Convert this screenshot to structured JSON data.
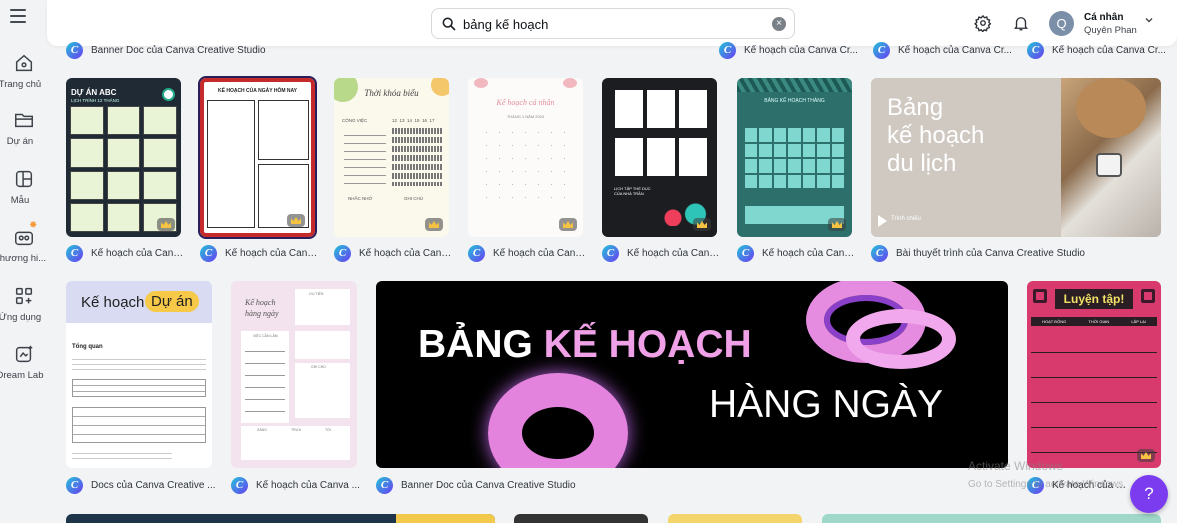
{
  "sidebar": {
    "items": [
      {
        "label": "Trang chủ",
        "icon": "home-icon"
      },
      {
        "label": "Dự án",
        "icon": "folder-icon"
      },
      {
        "label": "Mẫu",
        "icon": "template-icon"
      },
      {
        "label": "Thương hi...",
        "icon": "brand-icon"
      },
      {
        "label": "Ứng dụng",
        "icon": "apps-icon"
      },
      {
        "label": "Dream Lab",
        "icon": "dream-lab-icon"
      }
    ]
  },
  "header": {
    "search_value": "bảng kế hoạch",
    "clear_symbol": "×",
    "account_name": "Cá nhân",
    "account_sub": "Quyên Phan",
    "avatar_letter": "Q"
  },
  "top_captions": [
    "Banner Doc của Canva Creative Studio",
    "Kế hoạch của Canva Cr...",
    "Kế hoạch của Canva Cr...",
    "Kế hoạch của Canva Cr..."
  ],
  "row1": [
    {
      "caption": "Kế hoạch của Canva ...",
      "title": "DỰ ÁN ABC",
      "subtitle": "LỊCH TRÌNH 12 THÁNG"
    },
    {
      "caption": "Kế hoạch của Canva ...",
      "title": "KẾ HOẠCH CỦA NGÀY HÔM NAY"
    },
    {
      "caption": "Kế hoạch của Canva ...",
      "title": "Thời khóa biểu",
      "col1": "CÔNG VIỆC",
      "nums": "12  13  14  15  16  17",
      "note1": "NHẮC NHỞ",
      "note2": "GHI CHÚ"
    },
    {
      "caption": "Kế hoạch của Canva ...",
      "title": "Kế hoạch cá nhân",
      "subtitle": "THÁNG 1 NĂM 2024"
    },
    {
      "caption": "Kế hoạch của Canva ...",
      "title": "LỊCH TẬP THỂ DỤC CỦA NHÀ TRẦN"
    },
    {
      "caption": "Kế hoạch của Canva ...",
      "title": "BẢNG KẾ HOẠCH THÁNG"
    },
    {
      "caption": "Bài thuyết trình của Canva Creative Studio",
      "title_lines": [
        "Bảng",
        "kế hoạch",
        "du lịch"
      ],
      "footer": "Trình chiếu"
    }
  ],
  "row2": [
    {
      "caption": "Docs của Canva Creative ...",
      "title_a": "Kế hoạch",
      "title_b": "Dự án",
      "section": "Tổng quan"
    },
    {
      "caption": "Kế hoạch của Canva ...",
      "title": "Kế hoạch hàng ngày",
      "labels": [
        "ƯU TIÊN",
        "VIỆC CẦN LÀM",
        "GHI CHÚ",
        "SÁNG",
        "TRƯA",
        "TỐI"
      ]
    },
    {
      "caption": "Banner Doc của Canva Creative Studio",
      "line1_a": "BẢNG ",
      "line1_b": "KẾ HOẠCH",
      "line2": "HÀNG NGÀY"
    },
    {
      "caption": "Kế hoạch của Canva ...",
      "title": "Luyện tập!",
      "cols": [
        "HOẠT ĐỘNG",
        "THỜI GIAN",
        "LẶP LẠI"
      ]
    }
  ],
  "watermark": {
    "line1": "Activate Windows",
    "line2": "Go to Settings to activate Windows."
  },
  "help_label": "?",
  "colors": {
    "accent": "#7b3cf0",
    "pink": "#f0a0e6",
    "teal": "#2c6f6b"
  }
}
